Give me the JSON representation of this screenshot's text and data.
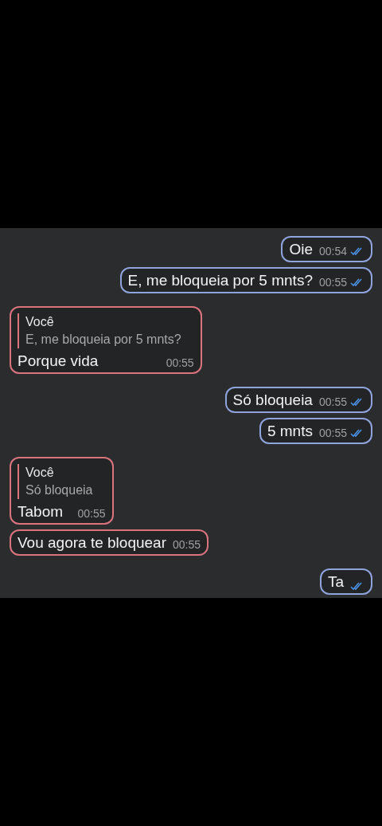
{
  "messages": [
    {
      "kind": "outgoing",
      "text": "Oie",
      "time": "00:54",
      "read": true
    },
    {
      "kind": "outgoing",
      "text": "E, me bloqueia por 5 mnts?",
      "time": "00:55",
      "read": true
    },
    {
      "kind": "incoming",
      "reply": {
        "author": "Você",
        "text": "E, me bloqueia por 5 mnts?"
      },
      "text": "Porque vida",
      "time": "00:55"
    },
    {
      "kind": "outgoing",
      "text": "Só bloqueia",
      "time": "00:55",
      "read": true
    },
    {
      "kind": "outgoing",
      "text": "5 mnts",
      "time": "00:55",
      "read": true
    },
    {
      "kind": "incoming",
      "reply": {
        "author": "Você",
        "text": "Só bloqueia"
      },
      "text": "Tabom",
      "time": "00:55"
    },
    {
      "kind": "incoming",
      "text": "Vou agora te bloquear",
      "time": "00:55"
    },
    {
      "kind": "outgoing",
      "text": "Ta",
      "read": true
    }
  ]
}
